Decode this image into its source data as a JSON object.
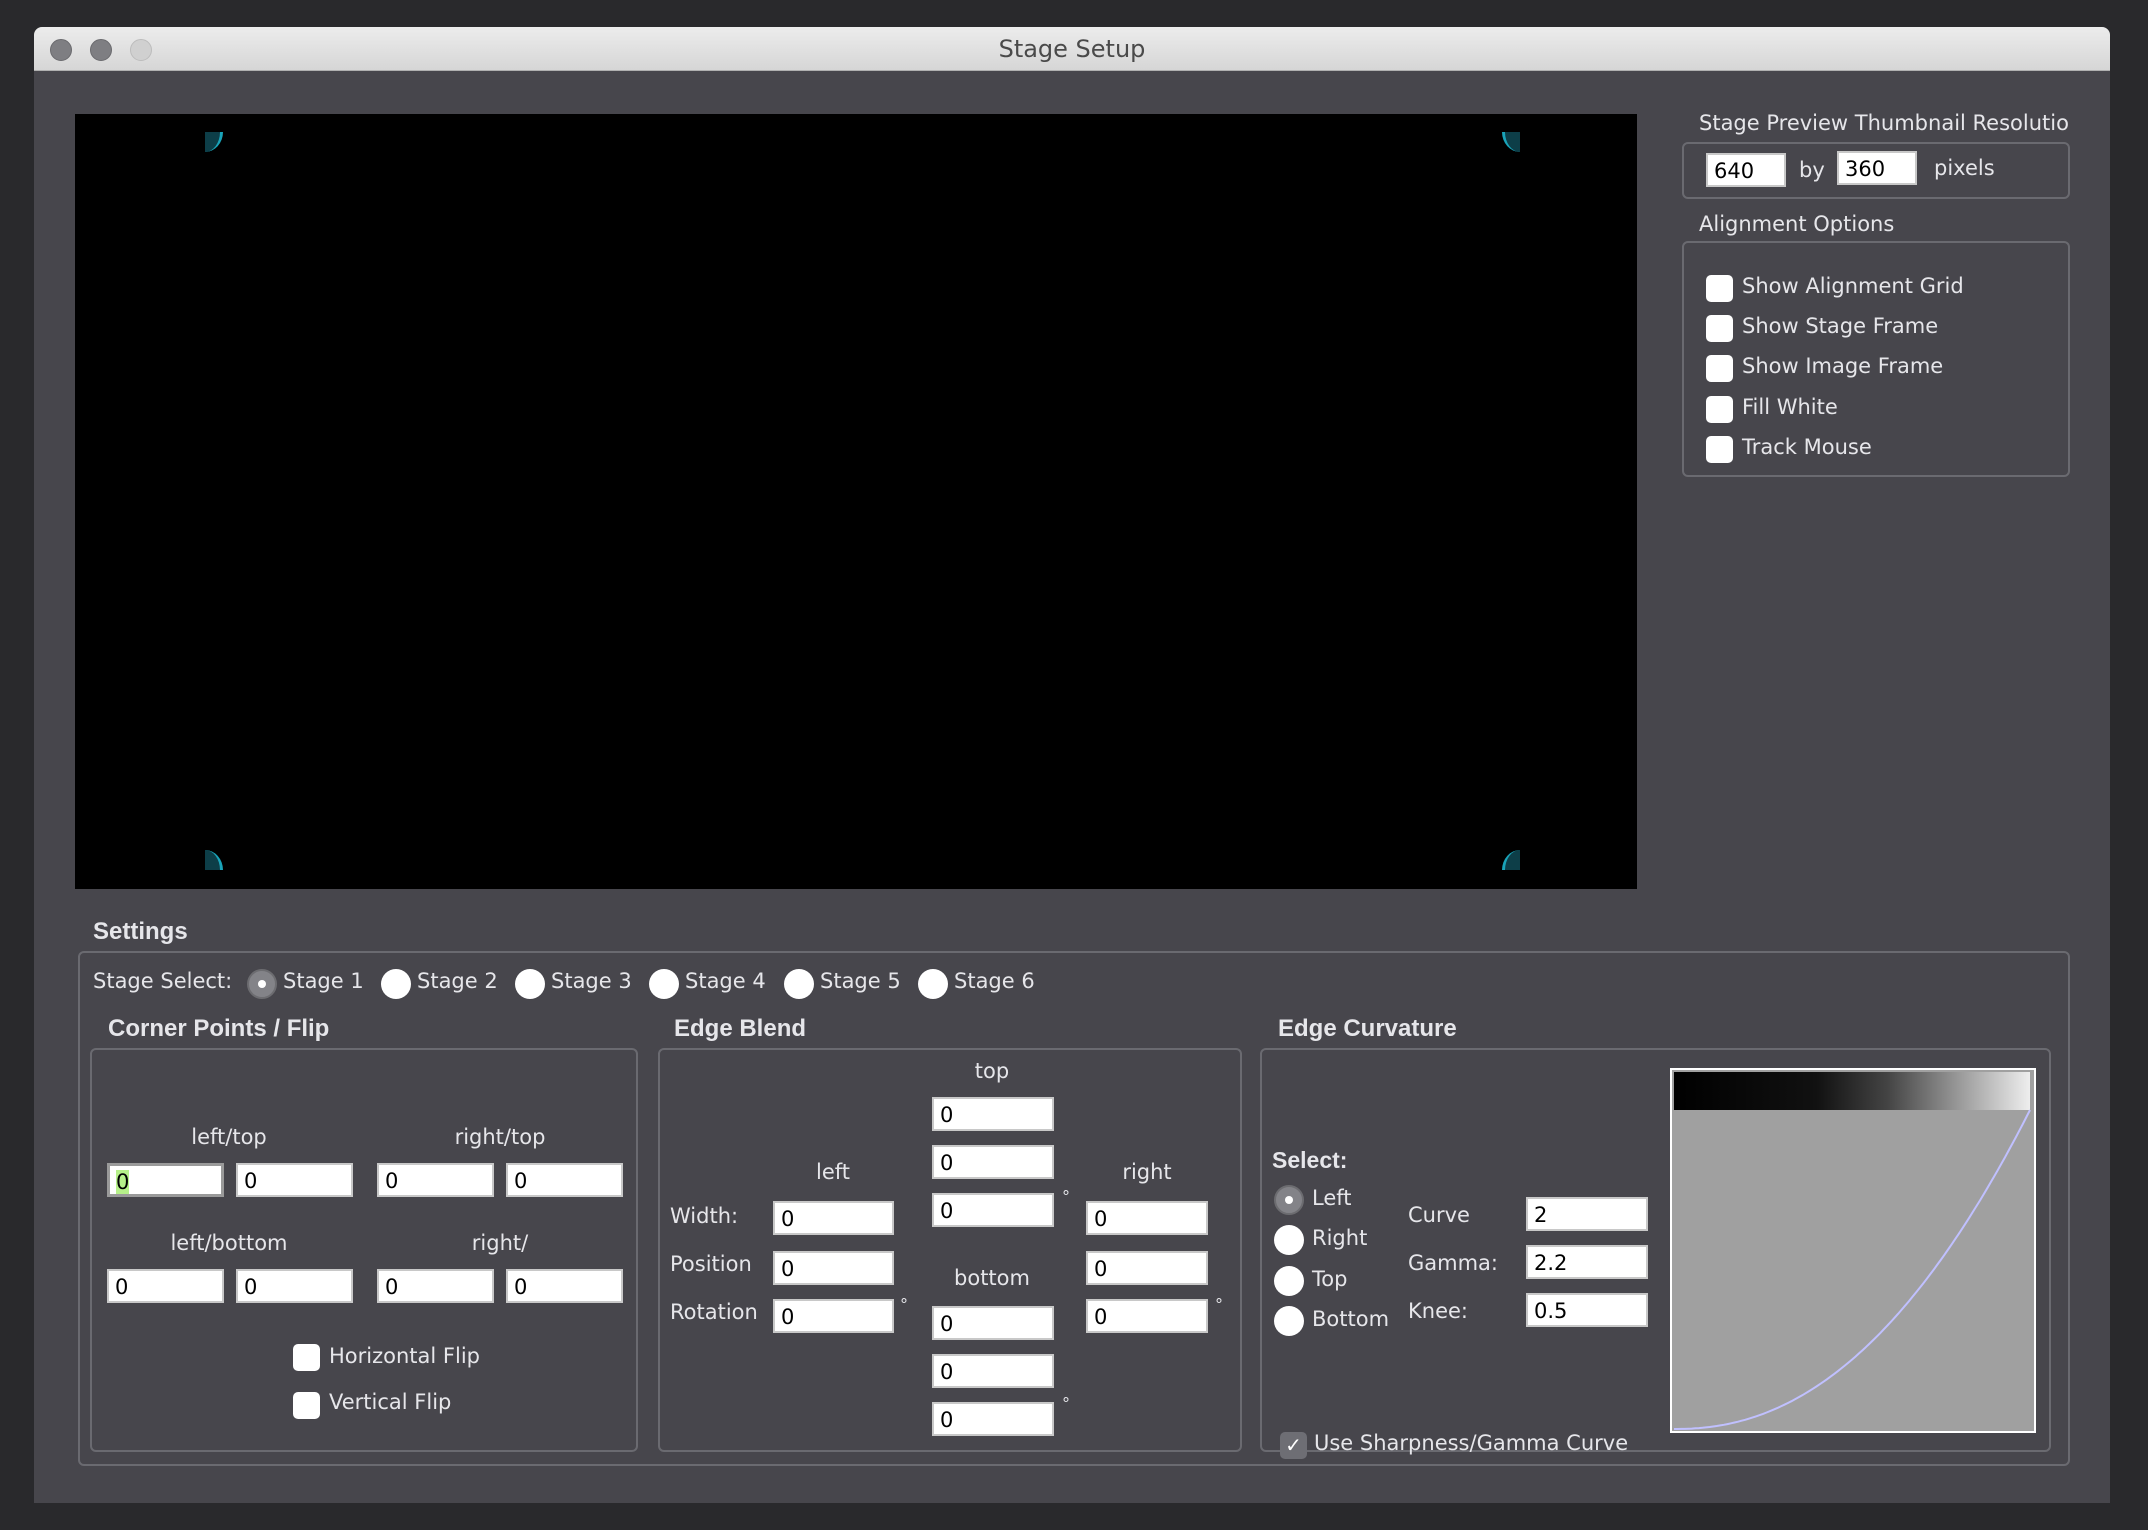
{
  "window": {
    "title": "Stage Setup"
  },
  "thumbnail": {
    "title": "Stage Preview Thumbnail Resolutio",
    "width": "640",
    "by": "by",
    "height": "360",
    "unit": "pixels"
  },
  "alignment": {
    "title": "Alignment Options",
    "options": [
      {
        "label": "Show Alignment Grid",
        "checked": false
      },
      {
        "label": "Show Stage Frame",
        "checked": false
      },
      {
        "label": "Show Image Frame",
        "checked": false
      },
      {
        "label": "Fill White",
        "checked": false
      },
      {
        "label": "Track Mouse",
        "checked": false
      }
    ]
  },
  "settings": {
    "title": "Settings",
    "stage_select_label": "Stage Select:",
    "stages": [
      "Stage 1",
      "Stage 2",
      "Stage 3",
      "Stage 4",
      "Stage 5",
      "Stage 6"
    ],
    "selected_stage": "Stage 1"
  },
  "corner_points": {
    "title": "Corner Points / Flip",
    "left_top_label": "left/top",
    "right_top_label": "right/top",
    "left_bottom_label": "left/bottom",
    "right_bottom_label": "right/",
    "left_top": [
      "0",
      "0"
    ],
    "right_top": [
      "0",
      "0"
    ],
    "left_bottom": [
      "0",
      "0"
    ],
    "right_bottom": [
      "0",
      "0"
    ],
    "horizontal_flip": "Horizontal Flip",
    "vertical_flip": "Vertical Flip"
  },
  "edge_blend": {
    "title": "Edge Blend",
    "top_label": "top",
    "bottom_label": "bottom",
    "left_label": "left",
    "right_label": "right",
    "width_label": "Width:",
    "position_label": "Position",
    "rotation_label": "Rotation",
    "degree": "°",
    "top": [
      "0",
      "0",
      "0"
    ],
    "bottom": [
      "0",
      "0",
      "0"
    ],
    "left": [
      "0",
      "0",
      "0"
    ],
    "right": [
      "0",
      "0",
      "0"
    ]
  },
  "edge_curvature": {
    "title": "Edge Curvature",
    "select_label": "Select:",
    "sides": [
      "Left",
      "Right",
      "Top",
      "Bottom"
    ],
    "selected_side": "Left",
    "curve_label": "Curve",
    "curve": "2",
    "gamma_label": "Gamma:",
    "gamma": "2.2",
    "knee_label": "Knee:",
    "knee": "0.5",
    "use_curve_label": "Use Sharpness/Gamma Curve",
    "use_curve": true,
    "curve_color": "#c0c0ff"
  }
}
